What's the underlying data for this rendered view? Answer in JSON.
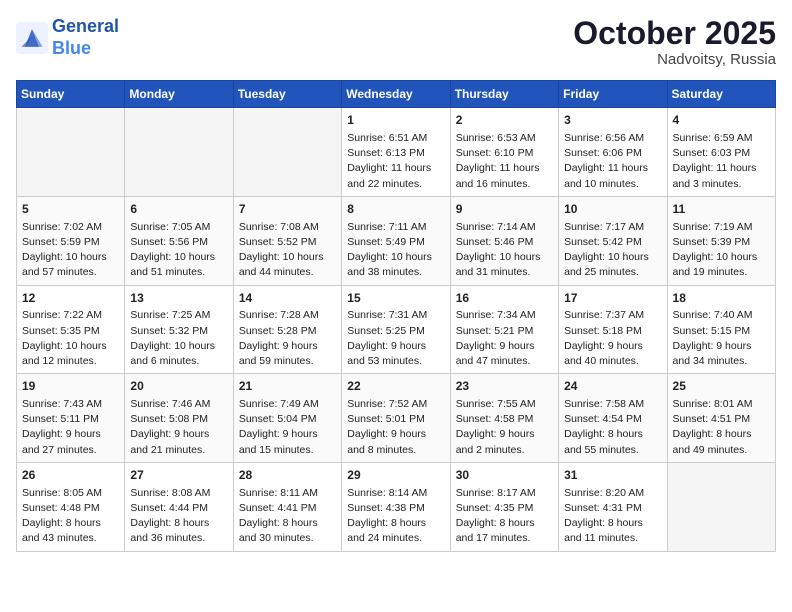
{
  "header": {
    "logo_line1": "General",
    "logo_line2": "Blue",
    "month": "October 2025",
    "location": "Nadvoitsy, Russia"
  },
  "weekdays": [
    "Sunday",
    "Monday",
    "Tuesday",
    "Wednesday",
    "Thursday",
    "Friday",
    "Saturday"
  ],
  "weeks": [
    [
      {
        "day": "",
        "info": ""
      },
      {
        "day": "",
        "info": ""
      },
      {
        "day": "",
        "info": ""
      },
      {
        "day": "1",
        "info": "Sunrise: 6:51 AM\nSunset: 6:13 PM\nDaylight: 11 hours\nand 22 minutes."
      },
      {
        "day": "2",
        "info": "Sunrise: 6:53 AM\nSunset: 6:10 PM\nDaylight: 11 hours\nand 16 minutes."
      },
      {
        "day": "3",
        "info": "Sunrise: 6:56 AM\nSunset: 6:06 PM\nDaylight: 11 hours\nand 10 minutes."
      },
      {
        "day": "4",
        "info": "Sunrise: 6:59 AM\nSunset: 6:03 PM\nDaylight: 11 hours\nand 3 minutes."
      }
    ],
    [
      {
        "day": "5",
        "info": "Sunrise: 7:02 AM\nSunset: 5:59 PM\nDaylight: 10 hours\nand 57 minutes."
      },
      {
        "day": "6",
        "info": "Sunrise: 7:05 AM\nSunset: 5:56 PM\nDaylight: 10 hours\nand 51 minutes."
      },
      {
        "day": "7",
        "info": "Sunrise: 7:08 AM\nSunset: 5:52 PM\nDaylight: 10 hours\nand 44 minutes."
      },
      {
        "day": "8",
        "info": "Sunrise: 7:11 AM\nSunset: 5:49 PM\nDaylight: 10 hours\nand 38 minutes."
      },
      {
        "day": "9",
        "info": "Sunrise: 7:14 AM\nSunset: 5:46 PM\nDaylight: 10 hours\nand 31 minutes."
      },
      {
        "day": "10",
        "info": "Sunrise: 7:17 AM\nSunset: 5:42 PM\nDaylight: 10 hours\nand 25 minutes."
      },
      {
        "day": "11",
        "info": "Sunrise: 7:19 AM\nSunset: 5:39 PM\nDaylight: 10 hours\nand 19 minutes."
      }
    ],
    [
      {
        "day": "12",
        "info": "Sunrise: 7:22 AM\nSunset: 5:35 PM\nDaylight: 10 hours\nand 12 minutes."
      },
      {
        "day": "13",
        "info": "Sunrise: 7:25 AM\nSunset: 5:32 PM\nDaylight: 10 hours\nand 6 minutes."
      },
      {
        "day": "14",
        "info": "Sunrise: 7:28 AM\nSunset: 5:28 PM\nDaylight: 9 hours\nand 59 minutes."
      },
      {
        "day": "15",
        "info": "Sunrise: 7:31 AM\nSunset: 5:25 PM\nDaylight: 9 hours\nand 53 minutes."
      },
      {
        "day": "16",
        "info": "Sunrise: 7:34 AM\nSunset: 5:21 PM\nDaylight: 9 hours\nand 47 minutes."
      },
      {
        "day": "17",
        "info": "Sunrise: 7:37 AM\nSunset: 5:18 PM\nDaylight: 9 hours\nand 40 minutes."
      },
      {
        "day": "18",
        "info": "Sunrise: 7:40 AM\nSunset: 5:15 PM\nDaylight: 9 hours\nand 34 minutes."
      }
    ],
    [
      {
        "day": "19",
        "info": "Sunrise: 7:43 AM\nSunset: 5:11 PM\nDaylight: 9 hours\nand 27 minutes."
      },
      {
        "day": "20",
        "info": "Sunrise: 7:46 AM\nSunset: 5:08 PM\nDaylight: 9 hours\nand 21 minutes."
      },
      {
        "day": "21",
        "info": "Sunrise: 7:49 AM\nSunset: 5:04 PM\nDaylight: 9 hours\nand 15 minutes."
      },
      {
        "day": "22",
        "info": "Sunrise: 7:52 AM\nSunset: 5:01 PM\nDaylight: 9 hours\nand 8 minutes."
      },
      {
        "day": "23",
        "info": "Sunrise: 7:55 AM\nSunset: 4:58 PM\nDaylight: 9 hours\nand 2 minutes."
      },
      {
        "day": "24",
        "info": "Sunrise: 7:58 AM\nSunset: 4:54 PM\nDaylight: 8 hours\nand 55 minutes."
      },
      {
        "day": "25",
        "info": "Sunrise: 8:01 AM\nSunset: 4:51 PM\nDaylight: 8 hours\nand 49 minutes."
      }
    ],
    [
      {
        "day": "26",
        "info": "Sunrise: 8:05 AM\nSunset: 4:48 PM\nDaylight: 8 hours\nand 43 minutes."
      },
      {
        "day": "27",
        "info": "Sunrise: 8:08 AM\nSunset: 4:44 PM\nDaylight: 8 hours\nand 36 minutes."
      },
      {
        "day": "28",
        "info": "Sunrise: 8:11 AM\nSunset: 4:41 PM\nDaylight: 8 hours\nand 30 minutes."
      },
      {
        "day": "29",
        "info": "Sunrise: 8:14 AM\nSunset: 4:38 PM\nDaylight: 8 hours\nand 24 minutes."
      },
      {
        "day": "30",
        "info": "Sunrise: 8:17 AM\nSunset: 4:35 PM\nDaylight: 8 hours\nand 17 minutes."
      },
      {
        "day": "31",
        "info": "Sunrise: 8:20 AM\nSunset: 4:31 PM\nDaylight: 8 hours\nand 11 minutes."
      },
      {
        "day": "",
        "info": ""
      }
    ]
  ]
}
